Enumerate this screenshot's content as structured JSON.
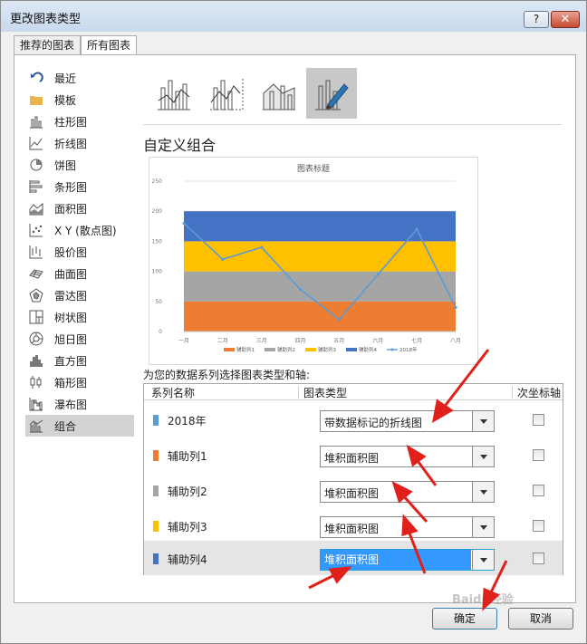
{
  "window": {
    "title": "更改图表类型",
    "help_glyph": "?",
    "close_glyph": "✕"
  },
  "tabs": [
    {
      "label": "推荐的图表"
    },
    {
      "label": "所有图表"
    }
  ],
  "sidebar": {
    "items": [
      {
        "label": "最近",
        "icon": "undo-icon"
      },
      {
        "label": "模板",
        "icon": "folder-icon"
      },
      {
        "label": "柱形图",
        "icon": "column-chart-icon"
      },
      {
        "label": "折线图",
        "icon": "line-chart-icon"
      },
      {
        "label": "饼图",
        "icon": "pie-chart-icon"
      },
      {
        "label": "条形图",
        "icon": "bar-chart-icon"
      },
      {
        "label": "面积图",
        "icon": "area-chart-icon"
      },
      {
        "label": "X Y (散点图)",
        "icon": "scatter-chart-icon"
      },
      {
        "label": "股价图",
        "icon": "stock-chart-icon"
      },
      {
        "label": "曲面图",
        "icon": "surface-chart-icon"
      },
      {
        "label": "雷达图",
        "icon": "radar-chart-icon"
      },
      {
        "label": "树状图",
        "icon": "treemap-icon"
      },
      {
        "label": "旭日图",
        "icon": "sunburst-icon"
      },
      {
        "label": "直方图",
        "icon": "histogram-icon"
      },
      {
        "label": "箱形图",
        "icon": "box-whisker-icon"
      },
      {
        "label": "瀑布图",
        "icon": "waterfall-icon"
      },
      {
        "label": "组合",
        "icon": "combo-chart-icon"
      }
    ],
    "selected": "组合"
  },
  "section_title": "自定义组合",
  "chart_data": {
    "type": "area",
    "title": "图表标题",
    "categories": [
      "一月",
      "二月",
      "三月",
      "四月",
      "五月",
      "六月",
      "七月",
      "八月"
    ],
    "ylim": [
      0,
      250
    ],
    "yticks": [
      0,
      50,
      100,
      150,
      200,
      250
    ],
    "grid": true,
    "legend": "bottom",
    "stacked_area_series": [
      {
        "name": "辅助列1",
        "color": "#ED7D31",
        "values": [
          50,
          50,
          50,
          50,
          50,
          50,
          50,
          50
        ]
      },
      {
        "name": "辅助列2",
        "color": "#A5A5A5",
        "values": [
          50,
          50,
          50,
          50,
          50,
          50,
          50,
          50
        ]
      },
      {
        "name": "辅助列3",
        "color": "#FFC000",
        "values": [
          50,
          50,
          50,
          50,
          50,
          50,
          50,
          50
        ]
      },
      {
        "name": "辅助列4",
        "color": "#4472C4",
        "values": [
          50,
          50,
          50,
          50,
          50,
          50,
          50,
          50
        ]
      }
    ],
    "line_series": {
      "name": "2018年",
      "color": "#5B9BD5",
      "values": [
        180,
        120,
        140,
        70,
        20,
        95,
        170,
        40
      ]
    }
  },
  "series_caption": "为您的数据系列选择图表类型和轴:",
  "series_table": {
    "headers": {
      "name": "系列名称",
      "type": "图表类型",
      "secondary": "次坐标轴"
    },
    "rows": [
      {
        "name": "2018年",
        "color": "#5B9BD5",
        "type": "带数据标记的折线图",
        "secondary": false
      },
      {
        "name": "辅助列1",
        "color": "#ED7D31",
        "type": "堆积面积图",
        "secondary": false
      },
      {
        "name": "辅助列2",
        "color": "#A5A5A5",
        "type": "堆积面积图",
        "secondary": false
      },
      {
        "name": "辅助列3",
        "color": "#FFC000",
        "type": "堆积面积图",
        "secondary": false
      },
      {
        "name": "辅助列4",
        "color": "#4472C4",
        "type": "堆积面积图",
        "secondary": false,
        "selected": true
      }
    ]
  },
  "buttons": {
    "ok": "确定",
    "cancel": "取消"
  },
  "watermark": "Baidu经验",
  "colors": {
    "annotation_arrow": "#e0201b",
    "selection": "#3399ff"
  }
}
